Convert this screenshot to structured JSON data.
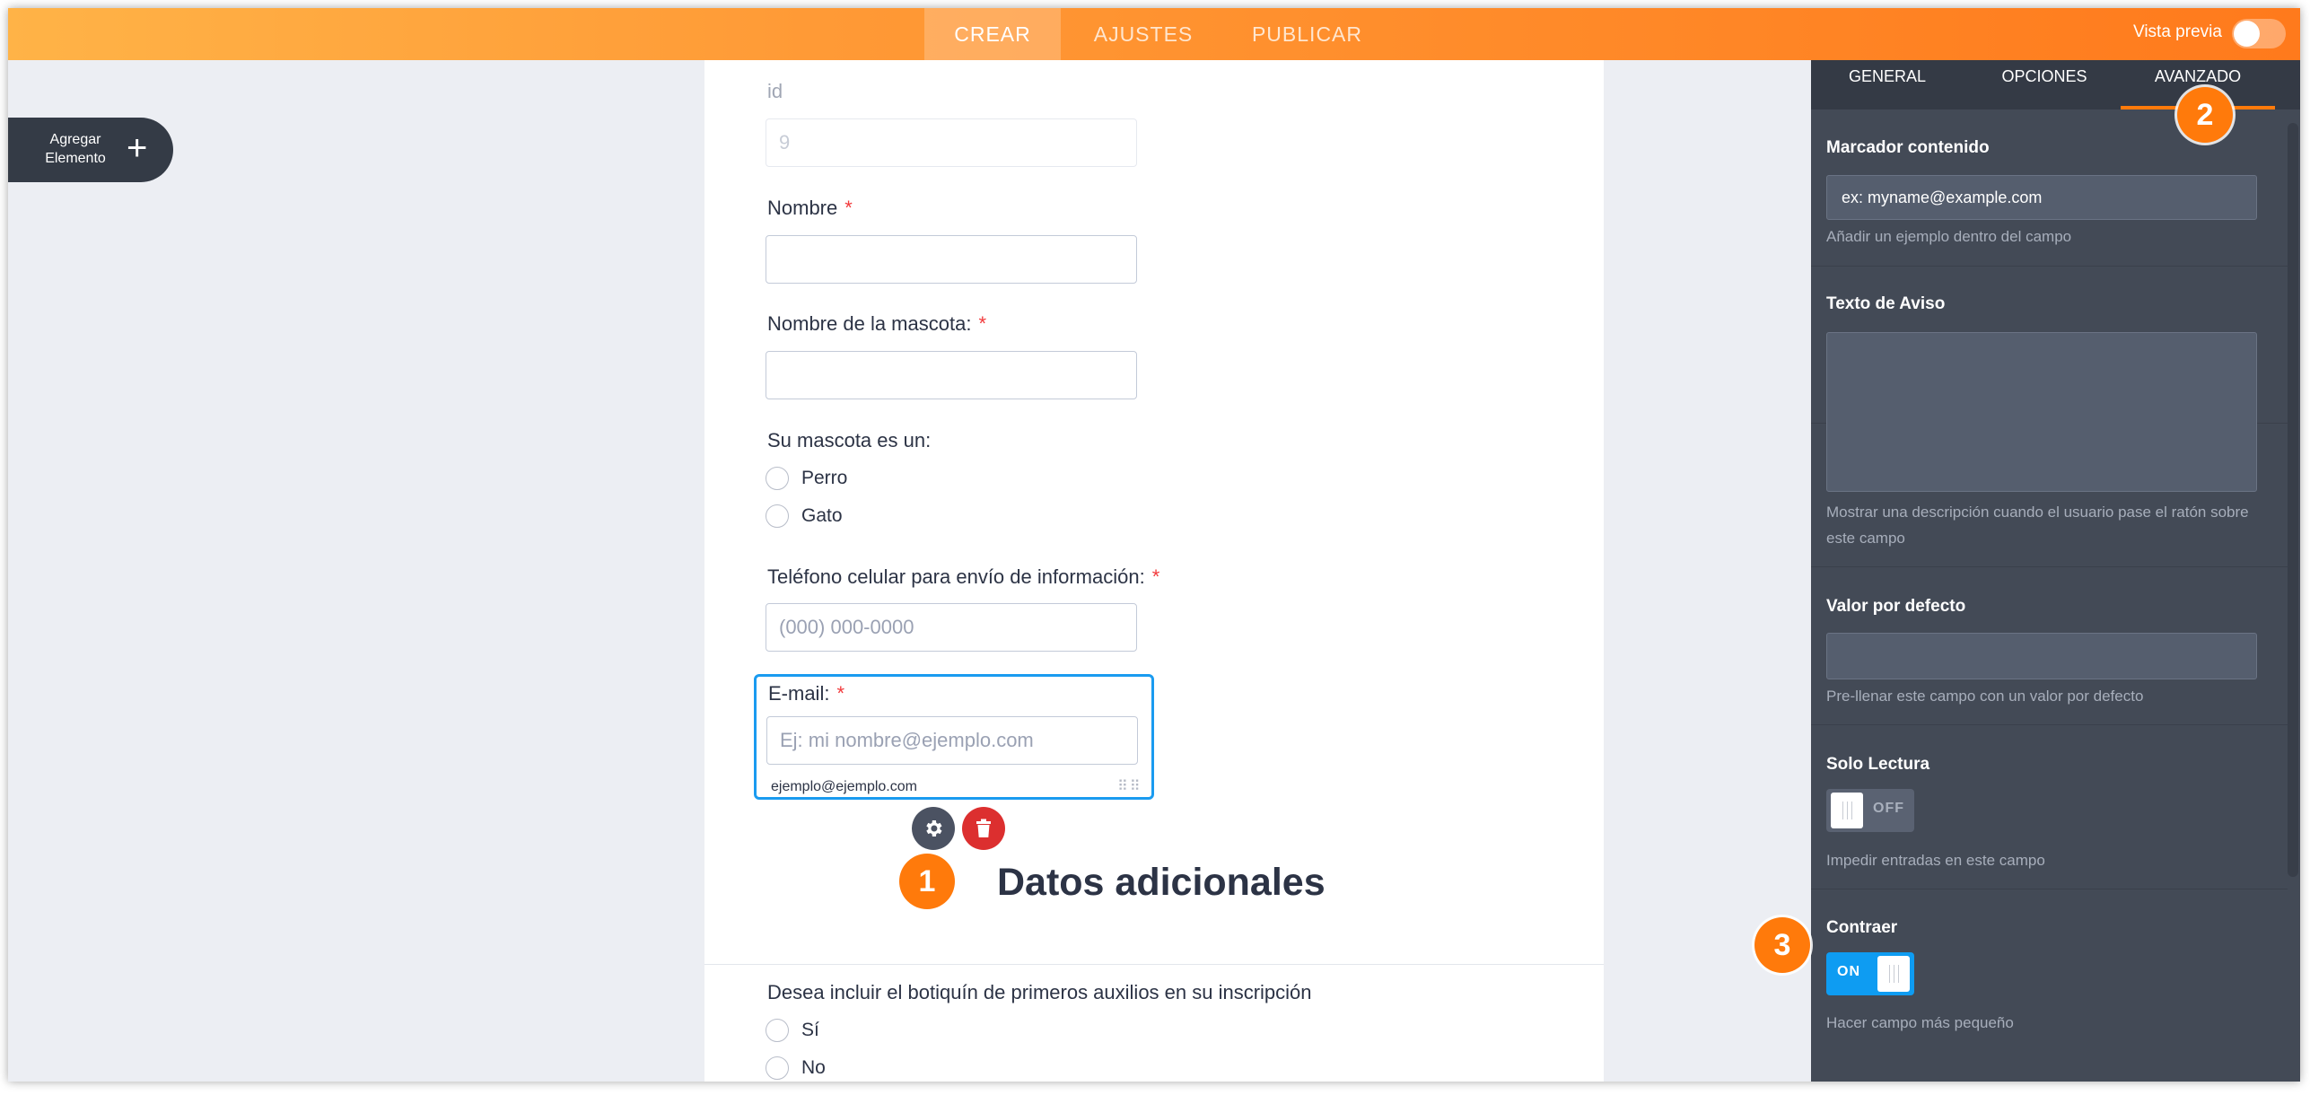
{
  "topbar": {
    "tabs": [
      "CREAR",
      "AJUSTES",
      "PUBLICAR"
    ],
    "preview_label": "Vista previa"
  },
  "add_element": {
    "label_line1": "Agregar",
    "label_line2": "Elemento"
  },
  "form": {
    "id_label": "id",
    "id_value": "9",
    "nombre_label": "Nombre",
    "mascota_label": "Nombre de la mascota:",
    "tipo_label": "Su mascota es un:",
    "tipo_options": [
      "Perro",
      "Gato"
    ],
    "telefono_label": "Teléfono celular para envío de información:",
    "telefono_placeholder": "(000) 000-0000",
    "email_label": "E-mail:",
    "email_placeholder": "Ej: mi nombre@ejemplo.com",
    "email_hint": "ejemplo@ejemplo.com",
    "required_mark": "*",
    "section_title": "Datos adicionales",
    "botiquin_label": "Desea incluir el botiquín de primeros auxilios en su inscripción",
    "botiquin_options": [
      "Sí",
      "No"
    ]
  },
  "badges": [
    "1",
    "2",
    "3"
  ],
  "panel": {
    "tabs": [
      "GENERAL",
      "OPCIONES",
      "AVANZADO"
    ],
    "active_tab": "AVANZADO",
    "marcador": {
      "title": "Marcador contenido",
      "value": "ex: myname@example.com",
      "desc": "Añadir un ejemplo dentro del campo"
    },
    "aviso": {
      "title": "Texto de Aviso",
      "value": "",
      "desc": "Mostrar una descripción cuando el usuario pase el ratón sobre este campo"
    },
    "defecto": {
      "title": "Valor por defecto",
      "value": "",
      "desc": "Pre-llenar este campo con un valor por defecto"
    },
    "solo_lectura": {
      "title": "Solo Lectura",
      "state": "OFF",
      "desc": "Impedir entradas en este campo"
    },
    "contraer": {
      "title": "Contraer",
      "state": "ON",
      "desc": "Hacer campo más pequeño"
    }
  },
  "colors": {
    "accent_orange": "#ff7a0b",
    "selection_blue": "#1a9bf0",
    "required_red": "#f23a3c",
    "delete_red": "#dc2f2f",
    "panel_bg": "#434a56"
  }
}
